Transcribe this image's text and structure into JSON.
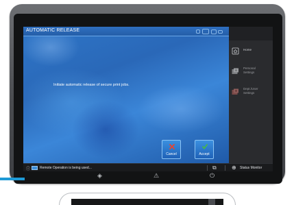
{
  "window": {
    "title": "AUTOMATIC RELEASE"
  },
  "dialog": {
    "message": "Initiate automatic release of secure print jobs.",
    "cancel_label": "Cancel",
    "accept_label": "Accept"
  },
  "status_bar": {
    "message": "Remote Operation is being used...",
    "status_monitor_label": "Status Monitor"
  },
  "side_menu": {
    "items": [
      {
        "label": "Home",
        "icon": "home-icon"
      },
      {
        "label": "Personal\nSettings",
        "icon": "personal-settings-icon"
      },
      {
        "label": "Dept./User\nSettings",
        "icon": "dept-user-settings-icon"
      }
    ]
  },
  "colors": {
    "accent_blue": "#1e9ad6",
    "screen_blue": "#2e76c8",
    "cancel_icon": "#e8452f",
    "accept_icon": "#47b84a"
  }
}
